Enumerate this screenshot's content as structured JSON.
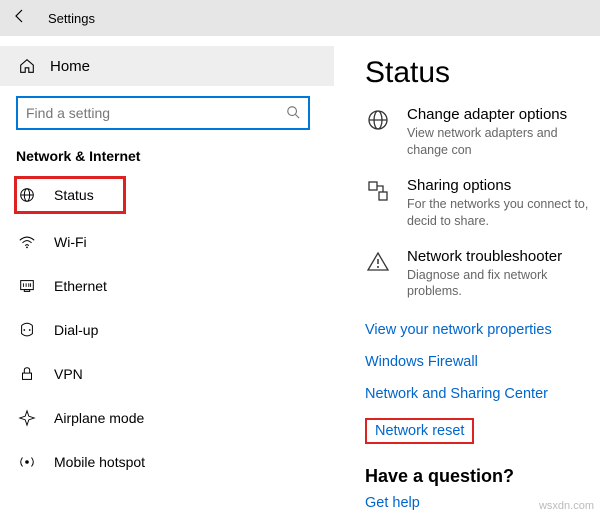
{
  "titlebar": {
    "title": "Settings"
  },
  "sidebar": {
    "home_label": "Home",
    "search_placeholder": "Find a setting",
    "section": "Network & Internet",
    "items": [
      {
        "label": "Status"
      },
      {
        "label": "Wi-Fi"
      },
      {
        "label": "Ethernet"
      },
      {
        "label": "Dial-up"
      },
      {
        "label": "VPN"
      },
      {
        "label": "Airplane mode"
      },
      {
        "label": "Mobile hotspot"
      }
    ]
  },
  "content": {
    "heading": "Status",
    "items": [
      {
        "title": "Change adapter options",
        "desc": "View network adapters and change con"
      },
      {
        "title": "Sharing options",
        "desc": "For the networks you connect to, decid to share."
      },
      {
        "title": "Network troubleshooter",
        "desc": "Diagnose and fix network problems."
      }
    ],
    "links": [
      "View your network properties",
      "Windows Firewall",
      "Network and Sharing Center",
      "Network reset"
    ],
    "question": "Have a question?",
    "help": "Get help"
  },
  "watermark": "wsxdn.com"
}
